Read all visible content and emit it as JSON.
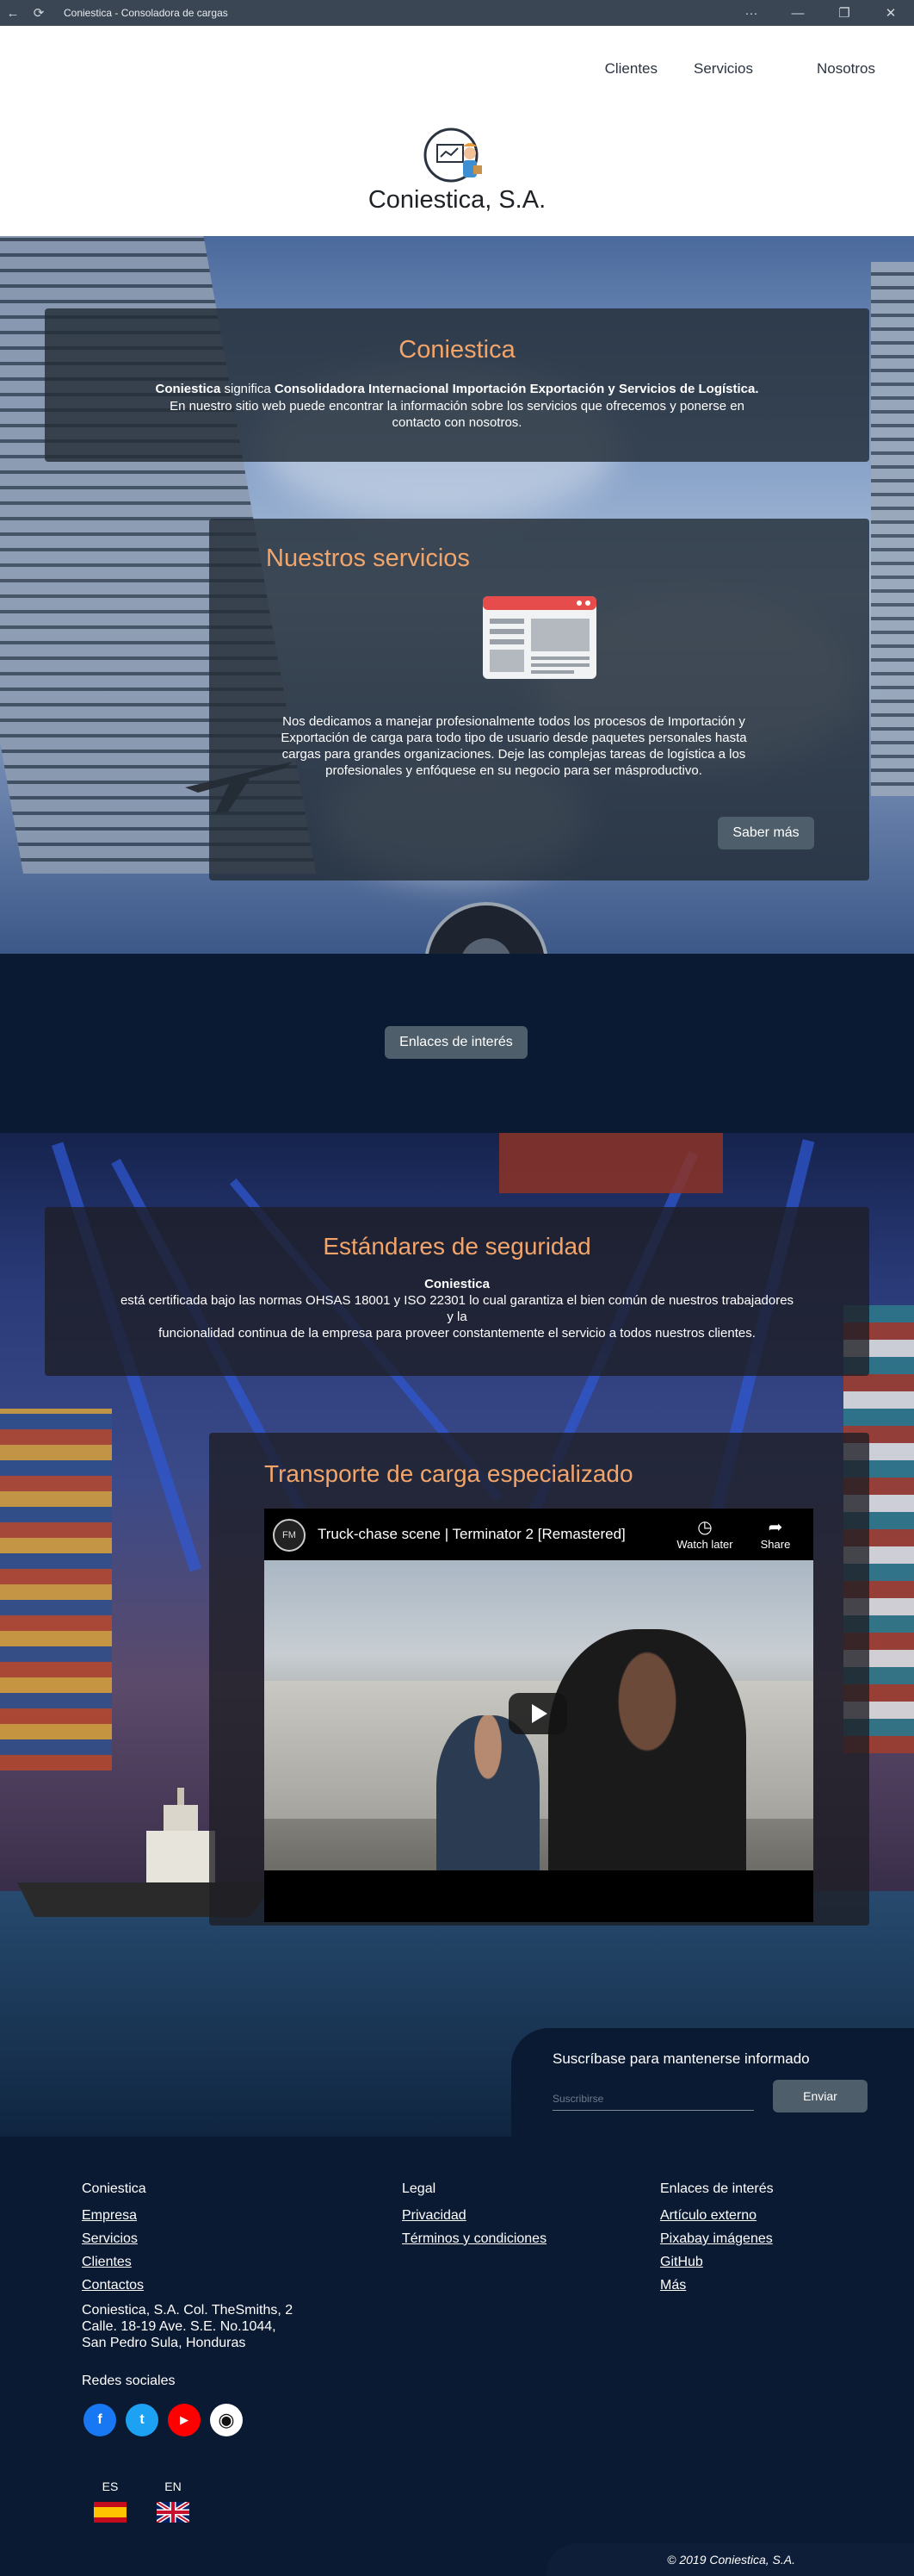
{
  "window": {
    "title": "Coniestica - Consoladora de cargas",
    "back_icon": "back-arrow-icon",
    "refresh_icon": "refresh-icon",
    "more_label": "···",
    "minimize_label": "—",
    "restore_label": "❐",
    "close_label": "✕"
  },
  "nav": {
    "items": [
      {
        "label": "Clientes"
      },
      {
        "label": "Servicios"
      },
      {
        "label": "Nosotros"
      }
    ]
  },
  "header": {
    "brand": "Coniestica, S.A."
  },
  "intro": {
    "title": "Coniestica",
    "brand_strong": "Coniestica",
    "significa": " significa ",
    "meaning": "Consolidadora Internacional Importación Exportación y Servicios de Logística.",
    "text": "En nuestro sitio web puede encontrar la información sobre los servicios que ofrecemos y ponerse en contacto con nosotros."
  },
  "services": {
    "title": "Nuestros servicios",
    "text": "Nos dedicamos a manejar profesionalmente todos los procesos de Importación y Exportación de carga para todo tipo de usuario desde paquetes personales hasta cargas para grandes organizaciones. Deje las complejas tareas de logística a los profesionales y enfóquese en su negocio para ser másproductivo.",
    "button": "Saber más"
  },
  "links_band": {
    "button": "Enlaces de interés"
  },
  "security": {
    "title": "Estándares de seguridad",
    "brand": "Coniestica",
    "line1": "está certificada bajo las normas OHSAS 18001 y ISO 22301 lo cual garantiza el bien común de nuestros trabajadores",
    "line2": "y la",
    "line3": "funcionalidad continua de la empresa para proveer constantemente el servicio a todos nuestros clientes."
  },
  "transport": {
    "title": "Transporte de carga especializado",
    "video": {
      "channel": "FM",
      "title": "Truck-chase scene | Terminator 2 [Remastered]",
      "watch_later": "Watch later",
      "share": "Share"
    }
  },
  "subscribe": {
    "title": "Suscríbase para mantenerse informado",
    "placeholder": "Suscribirse",
    "button": "Enviar"
  },
  "footer": {
    "col1": {
      "title": "Coniestica",
      "links": [
        "Empresa",
        "Servicios",
        "Clientes",
        "Contactos"
      ],
      "address": [
        "Coniestica, S.A. Col. TheSmiths, 2",
        "Calle. 18-19 Ave. S.E. No.1044,",
        "San Pedro Sula, Honduras"
      ]
    },
    "col2": {
      "title": "Legal",
      "links": [
        "Privacidad",
        "Términos y condiciones"
      ]
    },
    "col3": {
      "title": "Enlaces de interés",
      "links": [
        "Artículo externo",
        "Pixabay imágenes",
        "GitHub",
        "Más"
      ]
    },
    "social_title": "Redes sociales",
    "social": [
      {
        "icon": "facebook-icon",
        "color": "#1877f2",
        "glyph": "f"
      },
      {
        "icon": "twitter-icon",
        "color": "#1da1f2",
        "glyph": "t"
      },
      {
        "icon": "youtube-icon",
        "color": "#ff0000",
        "glyph": "▶"
      },
      {
        "icon": "github-icon",
        "color": "#ffffff",
        "glyph": "◉"
      }
    ],
    "languages": [
      {
        "code": "ES",
        "flag": "spain-flag-icon"
      },
      {
        "code": "EN",
        "flag": "uk-flag-icon"
      }
    ],
    "copyright": "© 2019 Coniestica, S.A."
  },
  "colors": {
    "accent": "#f2a56b",
    "navy": "#0b1a33",
    "button": "#4e5e6a"
  }
}
